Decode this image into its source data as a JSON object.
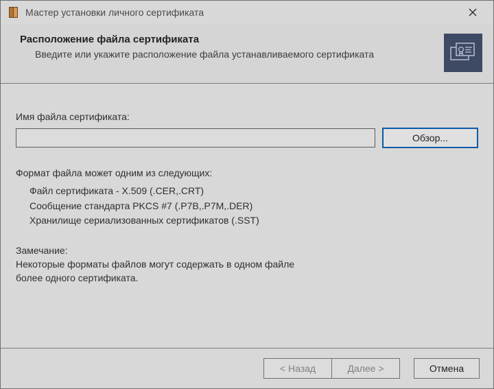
{
  "titlebar": {
    "title": "Мастер установки личного сертификата"
  },
  "header": {
    "title": "Расположение файла сертификата",
    "subtitle": "Введите или укажите расположение файла устанавливаемого сертификата"
  },
  "body": {
    "file_label": "Имя файла сертификата:",
    "file_value": "",
    "browse_label": "Обзор...",
    "format_label": "Формат файла может одним из следующих:",
    "formats": {
      "f1": "Файл сертификата - X.509 (.CER,.CRT)",
      "f2": "Сообщение стандарта PKCS #7 (.P7B,.P7M,.DER)",
      "f3": "Хранилище сериализованных сертификатов (.SST)"
    },
    "notice_label": "Замечание:",
    "notice_body_l1": "Некоторые форматы файлов могут содержать в одном файле",
    "notice_body_l2": "более одного сертификата."
  },
  "footer": {
    "back": "< Назад",
    "next": "Далее >",
    "cancel": "Отмена"
  },
  "icons": {
    "app": "app-icon",
    "close": "close-icon",
    "certificate": "certificate-icon"
  }
}
